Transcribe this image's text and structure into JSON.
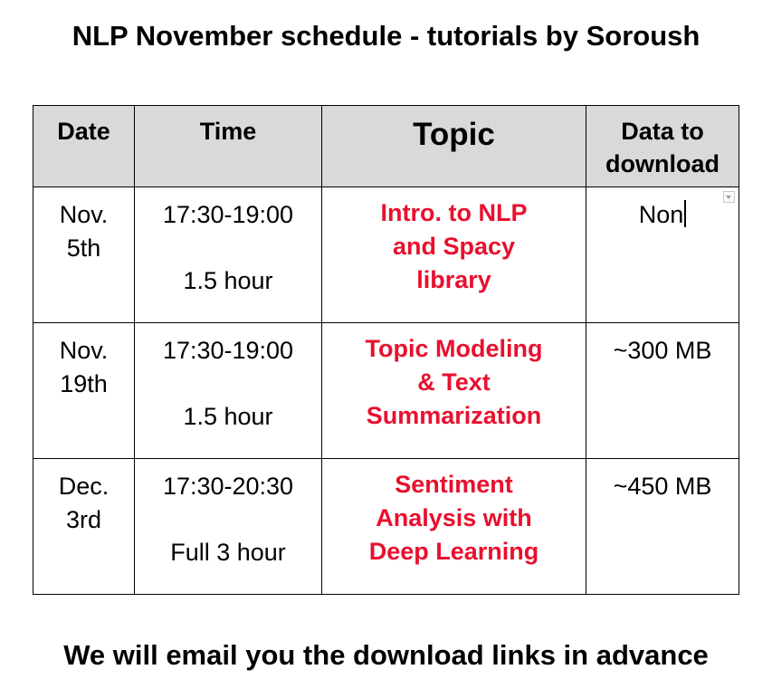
{
  "title": "NLP November schedule - tutorials by Soroush",
  "footer": "We will email you the download links in advance",
  "table": {
    "headers": {
      "date": "Date",
      "time": "Time",
      "topic": "Topic",
      "data_line1": "Data to",
      "data_line2": "download"
    },
    "rows": [
      {
        "date_line1": "Nov.",
        "date_line2": "5th",
        "time": "17:30-19:00",
        "duration": "1.5 hour",
        "topic_line1": "Intro. to NLP",
        "topic_line2": "and Spacy",
        "topic_line3": "library",
        "data": "Non"
      },
      {
        "date_line1": "Nov.",
        "date_line2": "19th",
        "time": "17:30-19:00",
        "duration": "1.5 hour",
        "topic_line1": "Topic Modeling",
        "topic_line2": "& Text",
        "topic_line3": "Summarization",
        "data": "~300 MB"
      },
      {
        "date_line1": "Dec.",
        "date_line2": "3rd",
        "time": "17:30-20:30",
        "duration": "Full 3 hour",
        "topic_line1": "Sentiment",
        "topic_line2": "Analysis with",
        "topic_line3": "Deep Learning",
        "data": "~450 MB"
      }
    ]
  },
  "colors": {
    "topic_text": "#e8102e",
    "header_bg": "#d9d9d9"
  },
  "icons": {
    "cell_dropdown": "chevron-down-icon"
  }
}
